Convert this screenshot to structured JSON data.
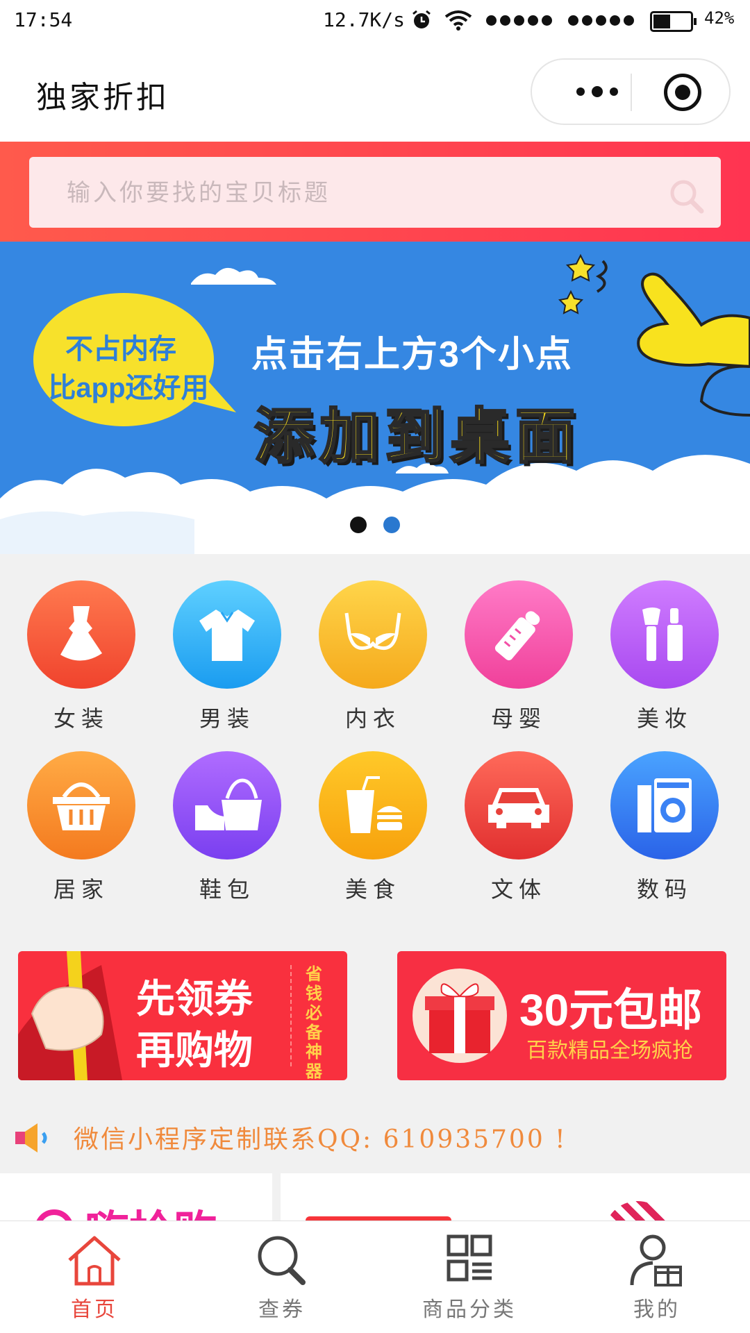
{
  "status_bar": {
    "time": "17:54",
    "speed": "12.7K/s",
    "battery_text": "42%",
    "battery_level": 0.42
  },
  "nav": {
    "title": "独家折扣"
  },
  "search": {
    "placeholder": "输入你要找的宝贝标题"
  },
  "banner": {
    "bubble_line1": "不占内存",
    "bubble_line2": "比app还好用",
    "line1": "点击右上方3个小点",
    "line2": "添加到桌面",
    "active_slide": 1,
    "slide_count": 2
  },
  "categories": [
    {
      "label": "女装",
      "icon": "dress-icon",
      "color_top": "#ff7a4f",
      "color_bottom": "#f0432d"
    },
    {
      "label": "男装",
      "icon": "shirt-icon",
      "color_top": "#5fd0ff",
      "color_bottom": "#1a9cf0"
    },
    {
      "label": "内衣",
      "icon": "bra-icon",
      "color_top": "#ffd54a",
      "color_bottom": "#f5a91c"
    },
    {
      "label": "母婴",
      "icon": "baby-bottle-icon",
      "color_top": "#ff7bc7",
      "color_bottom": "#f0409a"
    },
    {
      "label": "美妆",
      "icon": "makeup-icon",
      "color_top": "#d07dff",
      "color_bottom": "#a849f0"
    },
    {
      "label": "居家",
      "icon": "basket-icon",
      "color_top": "#ffab45",
      "color_bottom": "#f47a1f"
    },
    {
      "label": "鞋包",
      "icon": "shoe-bag-icon",
      "color_top": "#b06cff",
      "color_bottom": "#7a3ff0"
    },
    {
      "label": "美食",
      "icon": "food-icon",
      "color_top": "#ffc929",
      "color_bottom": "#f7a10d"
    },
    {
      "label": "文体",
      "icon": "car-icon",
      "color_top": "#ff6a5a",
      "color_bottom": "#e12f2f"
    },
    {
      "label": "数码",
      "icon": "washer-icon",
      "color_top": "#4aa3ff",
      "color_bottom": "#2a63e8"
    }
  ],
  "promos": {
    "left_line1": "先领券",
    "left_line2": "再购物",
    "left_vertical": "省钱必备神器",
    "right_title": "30元包邮",
    "right_sub": "百款精品全场疯抢"
  },
  "notice": {
    "text": "微信小程序定制联系QQ: 610935700 !"
  },
  "peek": {
    "left_title": "嗨抢购"
  },
  "tabs": [
    {
      "label": "首页",
      "icon": "home-icon",
      "active": true
    },
    {
      "label": "查券",
      "icon": "search-icon",
      "active": false
    },
    {
      "label": "商品分类",
      "icon": "category-icon",
      "active": false
    },
    {
      "label": "我的",
      "icon": "user-gift-icon",
      "active": false
    }
  ],
  "colors": {
    "accent": "#e8463c",
    "banner_bg": "#3587e2",
    "header_gradient_start": "#ff5a4c",
    "header_gradient_end": "#ff3451"
  }
}
